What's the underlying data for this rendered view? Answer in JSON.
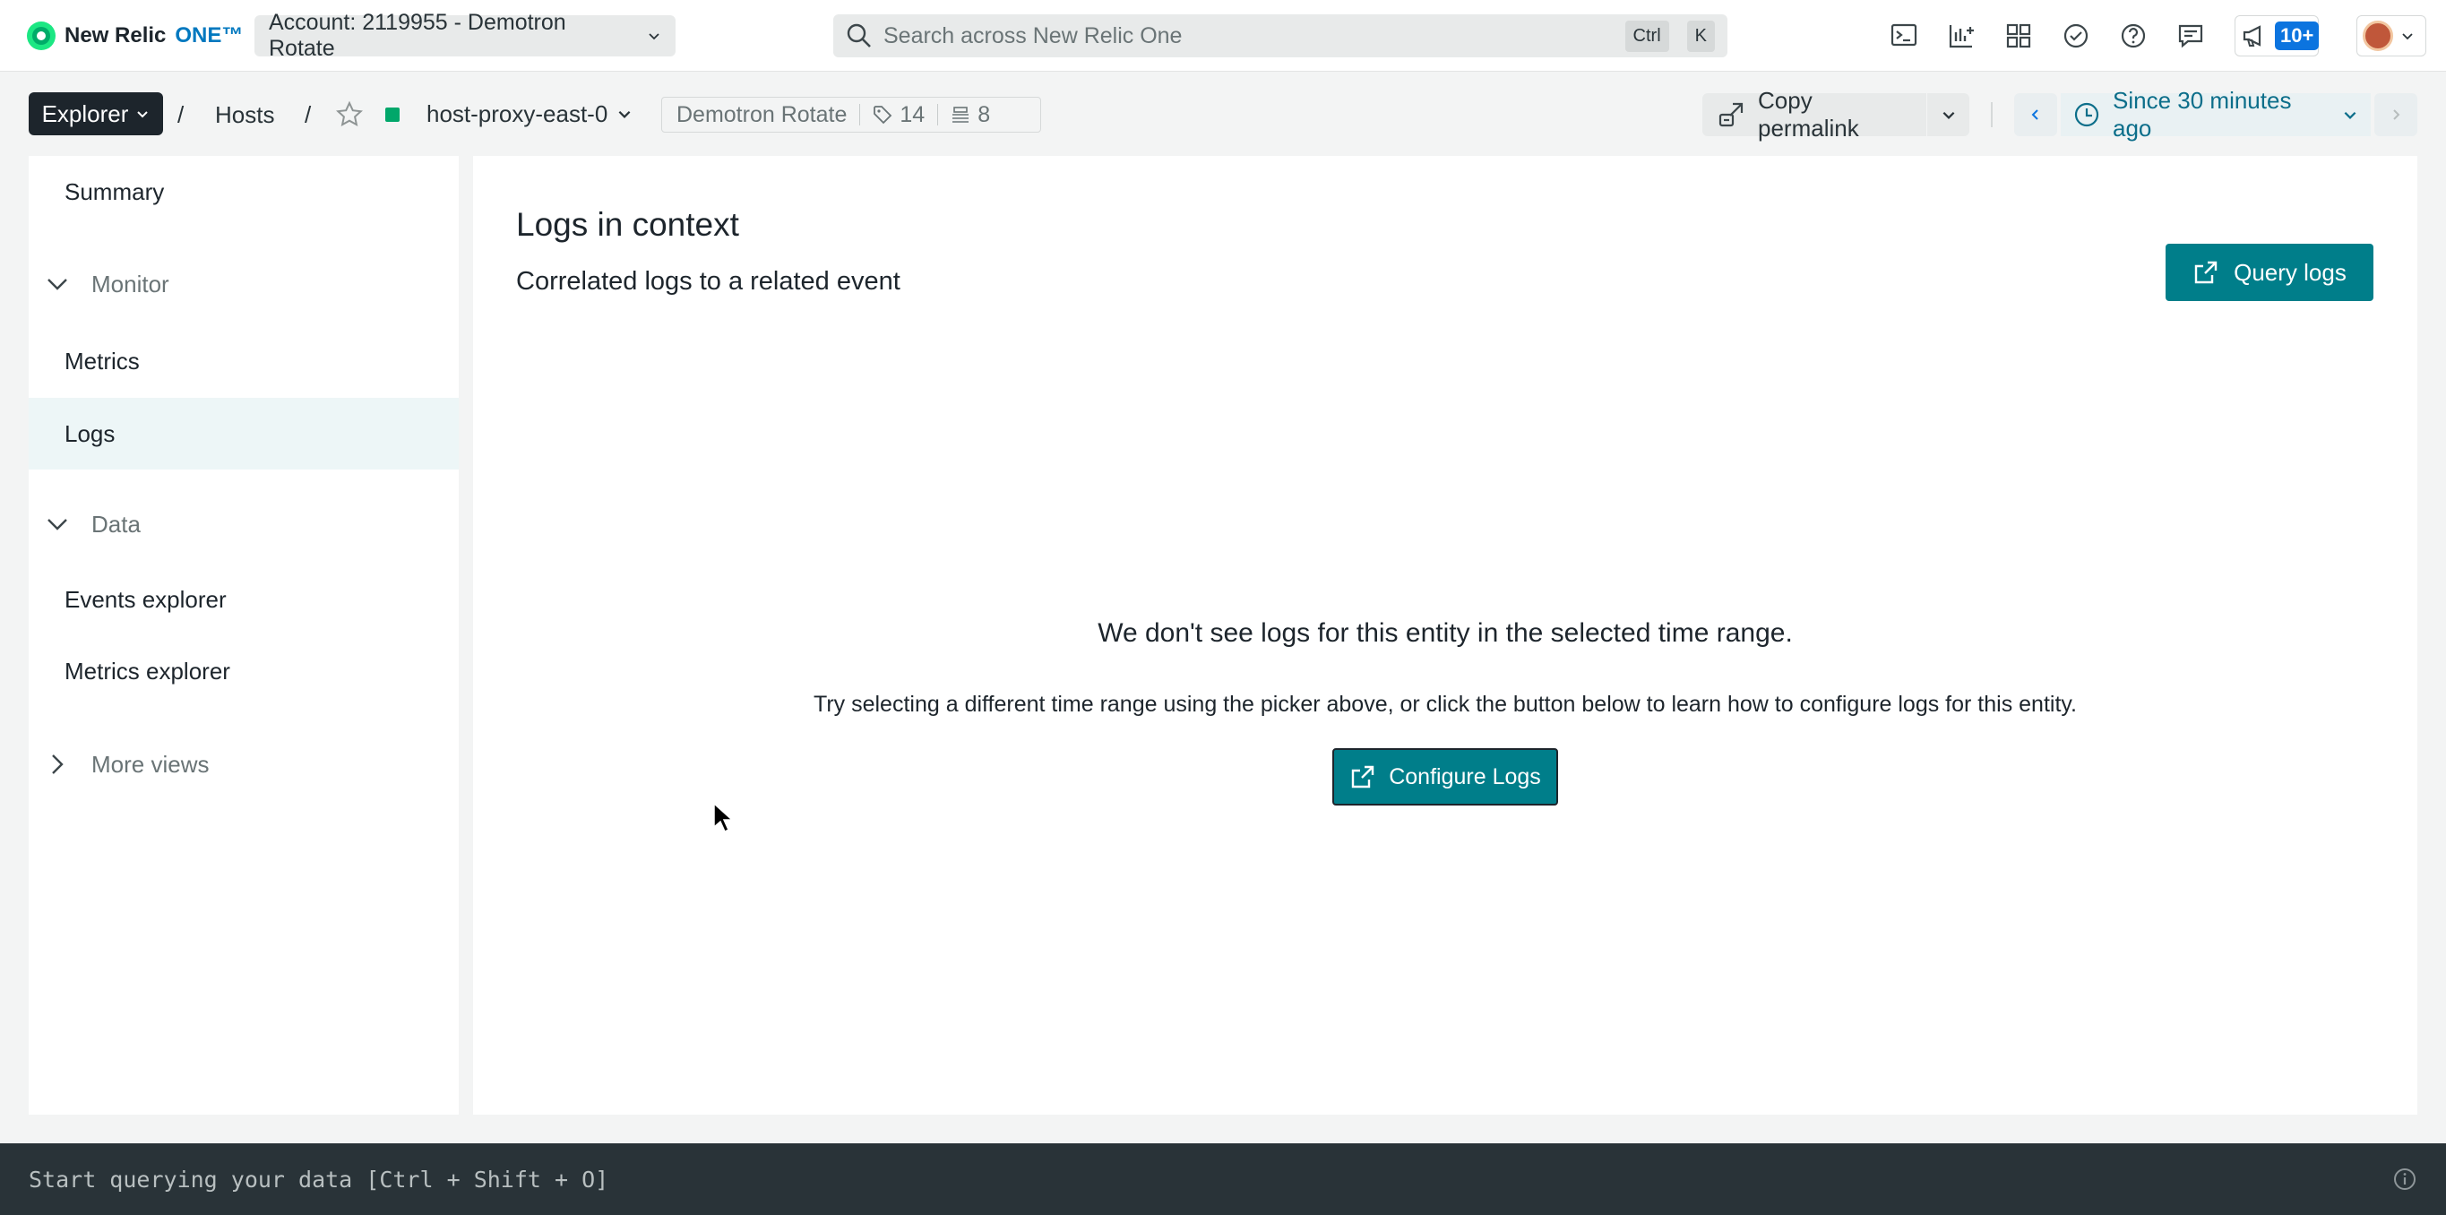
{
  "topbar": {
    "logo_text": "New Relic",
    "logo_one": "ONE™",
    "account_label": "Account: 2119955 - Demotron Rotate",
    "search_placeholder": "Search across New Relic One",
    "search_kbd_1": "Ctrl",
    "search_kbd_2": "K",
    "notifications_badge": "10+"
  },
  "breadcrumb": {
    "explorer_label": "Explorer",
    "separator": "/",
    "hosts_label": "Hosts",
    "entity_name": "host-proxy-east-0",
    "entity_status_color": "#01a76a",
    "account_tag": "Demotron Rotate",
    "tags_count": "14",
    "related_count": "8",
    "copy_permalink_label": "Copy permalink",
    "time_range_label": "Since 30 minutes ago"
  },
  "sidebar": {
    "summary": "Summary",
    "sections": [
      {
        "label": "Monitor",
        "items": [
          "Metrics",
          "Logs"
        ]
      },
      {
        "label": "Data",
        "items": [
          "Events explorer",
          "Metrics explorer"
        ]
      },
      {
        "label": "More views"
      }
    ],
    "active_item": "Logs"
  },
  "main": {
    "title": "Logs in context",
    "subtitle": "Correlated logs to a related event",
    "query_logs_label": "Query logs",
    "empty_title": "We don't see logs for this entity in the selected time range.",
    "empty_text": "Try selecting a different time range using the picker above, or click the button below to learn how to configure logs for this entity.",
    "configure_logs_label": "Configure Logs"
  },
  "querybar": {
    "placeholder": "Start querying your data [Ctrl + Shift + O]"
  },
  "colors": {
    "primary_button": "#007e8a",
    "active_nav_bg": "#edf6f7",
    "badge_blue": "#0c74df",
    "querybar_bg": "#293338"
  }
}
